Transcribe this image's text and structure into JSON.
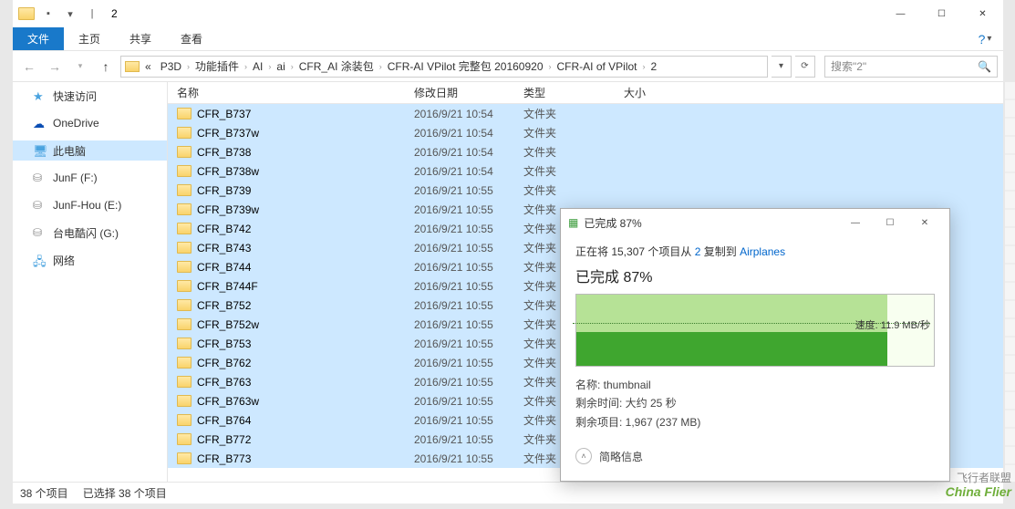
{
  "window": {
    "title": "2",
    "controls": {
      "min": "—",
      "max": "☐",
      "close": "✕"
    }
  },
  "ribbon": {
    "file": "文件",
    "tabs": [
      "主页",
      "共享",
      "查看"
    ],
    "help": "?"
  },
  "nav": {
    "back": "←",
    "fwd": "→",
    "up": "↑",
    "crumbs": [
      "«",
      "P3D",
      "功能插件",
      "AI",
      "ai",
      "CFR_AI 涂装包",
      "CFR-AI VPilot 完整包 20160920",
      "CFR-AI of VPilot",
      "2"
    ],
    "refresh": "⟳",
    "search_placeholder": "搜索\"2\""
  },
  "sidebar": {
    "items": [
      {
        "icon": "star",
        "label": "快速访问"
      },
      {
        "icon": "cloud",
        "label": "OneDrive"
      },
      {
        "icon": "pc",
        "label": "此电脑",
        "selected": true
      },
      {
        "icon": "disk",
        "label": "JunF (F:)"
      },
      {
        "icon": "disk",
        "label": "JunF-Hou (E:)"
      },
      {
        "icon": "disk",
        "label": "台电酷闪 (G:)"
      },
      {
        "icon": "net",
        "label": "网络"
      }
    ]
  },
  "columns": {
    "name": "名称",
    "date": "修改日期",
    "type": "类型",
    "size": "大小"
  },
  "files": [
    {
      "name": "CFR_B737",
      "date": "2016/9/21 10:54",
      "type": "文件夹"
    },
    {
      "name": "CFR_B737w",
      "date": "2016/9/21 10:54",
      "type": "文件夹"
    },
    {
      "name": "CFR_B738",
      "date": "2016/9/21 10:54",
      "type": "文件夹"
    },
    {
      "name": "CFR_B738w",
      "date": "2016/9/21 10:54",
      "type": "文件夹"
    },
    {
      "name": "CFR_B739",
      "date": "2016/9/21 10:55",
      "type": "文件夹"
    },
    {
      "name": "CFR_B739w",
      "date": "2016/9/21 10:55",
      "type": "文件夹"
    },
    {
      "name": "CFR_B742",
      "date": "2016/9/21 10:55",
      "type": "文件夹"
    },
    {
      "name": "CFR_B743",
      "date": "2016/9/21 10:55",
      "type": "文件夹"
    },
    {
      "name": "CFR_B744",
      "date": "2016/9/21 10:55",
      "type": "文件夹"
    },
    {
      "name": "CFR_B744F",
      "date": "2016/9/21 10:55",
      "type": "文件夹"
    },
    {
      "name": "CFR_B752",
      "date": "2016/9/21 10:55",
      "type": "文件夹"
    },
    {
      "name": "CFR_B752w",
      "date": "2016/9/21 10:55",
      "type": "文件夹"
    },
    {
      "name": "CFR_B753",
      "date": "2016/9/21 10:55",
      "type": "文件夹"
    },
    {
      "name": "CFR_B762",
      "date": "2016/9/21 10:55",
      "type": "文件夹"
    },
    {
      "name": "CFR_B763",
      "date": "2016/9/21 10:55",
      "type": "文件夹"
    },
    {
      "name": "CFR_B763w",
      "date": "2016/9/21 10:55",
      "type": "文件夹"
    },
    {
      "name": "CFR_B764",
      "date": "2016/9/21 10:55",
      "type": "文件夹"
    },
    {
      "name": "CFR_B772",
      "date": "2016/9/21 10:55",
      "type": "文件夹"
    },
    {
      "name": "CFR_B773",
      "date": "2016/9/21 10:55",
      "type": "文件夹"
    }
  ],
  "status": {
    "items": "38 个项目",
    "selected": "已选择 38 个项目"
  },
  "dialog": {
    "title": "已完成 87%",
    "copy_prefix": "正在将 15,307 个项目从 ",
    "copy_src": "2",
    "copy_mid": " 复制到 ",
    "copy_dst": "Airplanes",
    "percent": "已完成 87%",
    "pause": "❚❚",
    "cancel": "✕",
    "speed": "速度: 11.9 MB/秒",
    "name_label": "名称: ",
    "name_val": "thumbnail",
    "remain_label": "剩余时间: ",
    "remain_val": "大约 25 秒",
    "left_label": "剩余项目: ",
    "left_val": "1,967 (237 MB)",
    "more": "简略信息",
    "min": "—",
    "max": "☐",
    "close": "✕"
  },
  "watermark": {
    "zh": "飞行者联盟",
    "en": "China Flier"
  }
}
